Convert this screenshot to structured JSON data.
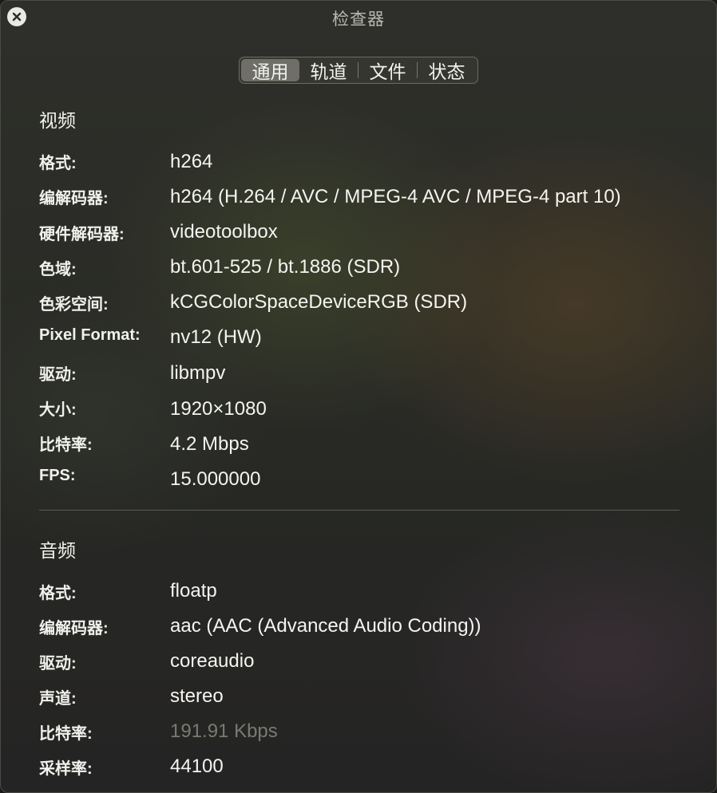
{
  "window": {
    "title": "检查器"
  },
  "tabs": [
    {
      "label": "通用",
      "active": true
    },
    {
      "label": "轨道",
      "active": false
    },
    {
      "label": "文件",
      "active": false
    },
    {
      "label": "状态",
      "active": false
    }
  ],
  "video": {
    "title": "视频",
    "rows": [
      {
        "label": "格式:",
        "value": "h264"
      },
      {
        "label": "编解码器:",
        "value": "h264 (H.264 / AVC / MPEG-4 AVC / MPEG-4 part 10)"
      },
      {
        "label": "硬件解码器:",
        "value": "videotoolbox"
      },
      {
        "label": "色域:",
        "value": "bt.601-525 / bt.1886 (SDR)"
      },
      {
        "label": "色彩空间:",
        "value": "kCGColorSpaceDeviceRGB (SDR)"
      },
      {
        "label": "Pixel Format:",
        "value": "nv12 (HW)"
      },
      {
        "label": "驱动:",
        "value": "libmpv"
      },
      {
        "label": "大小:",
        "value": "1920×1080"
      },
      {
        "label": "比特率:",
        "value": "4.2 Mbps"
      },
      {
        "label": "FPS:",
        "value": "15.000000"
      }
    ]
  },
  "audio": {
    "title": "音频",
    "rows": [
      {
        "label": "格式:",
        "value": "floatp"
      },
      {
        "label": "编解码器:",
        "value": "aac (AAC (Advanced Audio Coding))"
      },
      {
        "label": "驱动:",
        "value": "coreaudio"
      },
      {
        "label": "声道:",
        "value": "stereo"
      },
      {
        "label": "比特率:",
        "value": "191.91 Kbps"
      },
      {
        "label": "采样率:",
        "value": "44100"
      }
    ]
  },
  "colors": {
    "window_bg": "#2a2b26",
    "active_tab": "#6f6f68",
    "dim_value": "#7a7a74"
  },
  "icons": {
    "close": "close-icon"
  }
}
